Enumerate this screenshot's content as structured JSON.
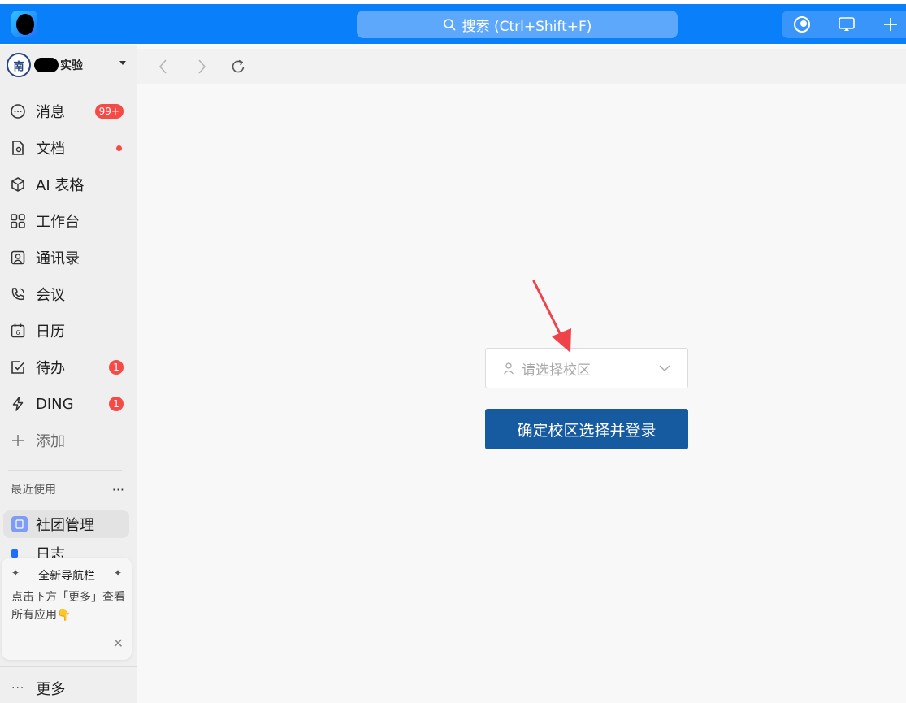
{
  "titlebar": {
    "search_placeholder": "搜索 (Ctrl+Shift+F)",
    "accent": "#0a7ffa"
  },
  "sidebar": {
    "org_avatar_text": "南",
    "org_name": "实验",
    "nav": [
      {
        "label": "消息",
        "icon": "chat-bubble-icon",
        "badge": "99+"
      },
      {
        "label": "文档",
        "icon": "document-icon",
        "dot": true
      },
      {
        "label": "AI 表格",
        "icon": "cube-icon"
      },
      {
        "label": "工作台",
        "icon": "grid-icon"
      },
      {
        "label": "通讯录",
        "icon": "contacts-icon"
      },
      {
        "label": "会议",
        "icon": "phone-icon"
      },
      {
        "label": "日历",
        "icon": "calendar-icon",
        "calendar_day": "6"
      },
      {
        "label": "待办",
        "icon": "checkbox-icon",
        "badge": "1"
      },
      {
        "label": "DING",
        "icon": "lightning-icon",
        "badge": "1"
      },
      {
        "label": "添加",
        "icon": "plus-icon"
      }
    ],
    "recent_title": "最近使用",
    "recent_more": "···",
    "recent_items": [
      {
        "label": "社团管理"
      },
      {
        "label": "日志"
      }
    ],
    "tip": {
      "title": "全新导航栏",
      "spark": "✦",
      "body": "点击下方「更多」查看所有应用👇",
      "close": "✕"
    },
    "more_dots": "···",
    "more_label": "更多",
    "badge_color": "#f54a45"
  },
  "main": {
    "campus_placeholder": "请选择校区",
    "login_button": "确定校区选择并登录",
    "button_color": "#165aa0",
    "annotation_color": "#f0424a"
  }
}
